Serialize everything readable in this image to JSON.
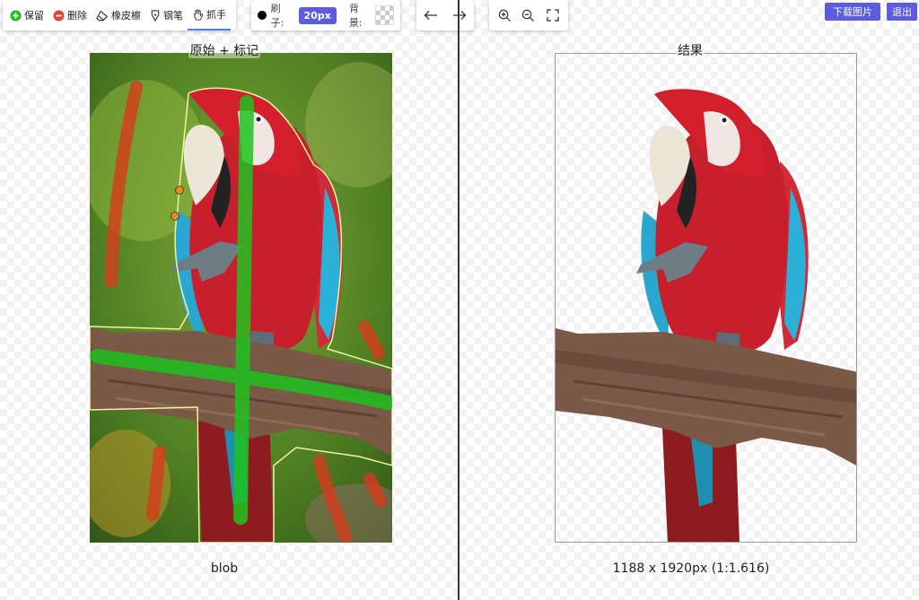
{
  "toolbar": {
    "keep_label": "保留",
    "delete_label": "删除",
    "eraser_label": "橡皮檫",
    "pen_label": "钢笔",
    "grab_label": "抓手",
    "brush_label": "刷子:",
    "brush_size": "20px",
    "background_label": "背景:"
  },
  "actions": {
    "download_label": "下载图片",
    "exit_label": "退出"
  },
  "left": {
    "title": "原始 + 标记",
    "caption": "blob"
  },
  "right": {
    "title": "结果",
    "caption": "1188 x 1920px (1:1.616)"
  },
  "colors": {
    "accent": "#5b5ce0",
    "keep_mark": "#1fc21f",
    "delete_mark": "#d93a1a",
    "selection_outline": "#f2f2a0"
  }
}
